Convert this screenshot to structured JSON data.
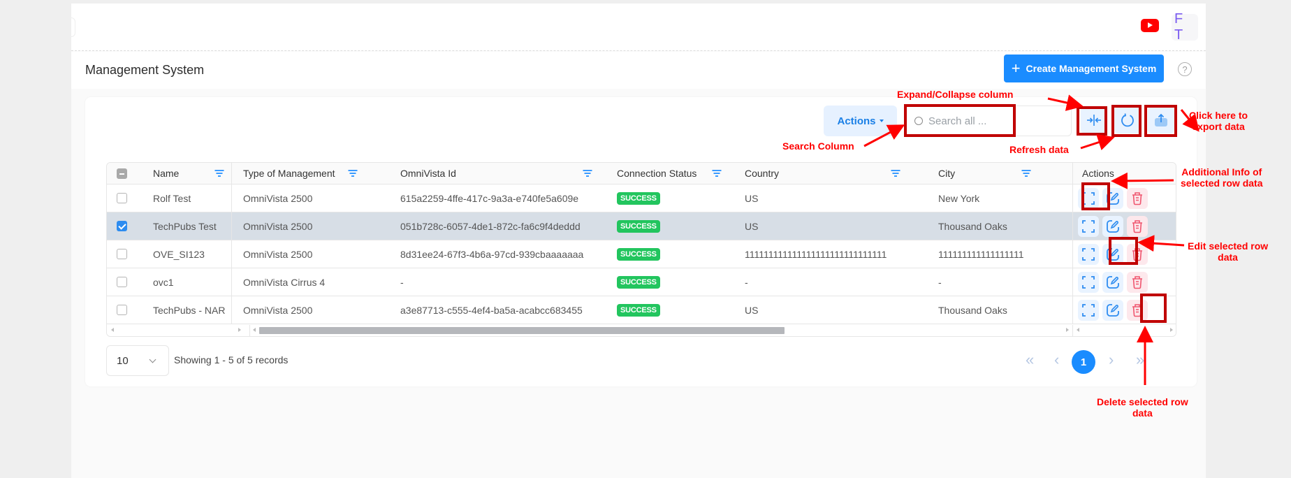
{
  "topbar": {
    "youtube_icon": "youtube-icon",
    "avatar_initials": "F T"
  },
  "page": {
    "title": "Management System",
    "create_button_label": "Create Management System",
    "create_button_icon": "plus-icon",
    "help_icon_glyph": "?"
  },
  "toolbar": {
    "actions_label": "Actions",
    "search_placeholder": "Search all ...",
    "search_value": "",
    "expand_collapse_icon": "expand-collapse-icon",
    "refresh_icon": "refresh-icon",
    "export_icon": "export-icon"
  },
  "table": {
    "columns": [
      {
        "key": "name",
        "label": "Name"
      },
      {
        "key": "type",
        "label": "Type of Management"
      },
      {
        "key": "omnivista_id",
        "label": "OmniVista Id"
      },
      {
        "key": "status",
        "label": "Connection Status"
      },
      {
        "key": "country",
        "label": "Country"
      },
      {
        "key": "city",
        "label": "City"
      },
      {
        "key": "actions",
        "label": "Actions"
      }
    ],
    "rows": [
      {
        "name": "Rolf Test",
        "type": "OmniVista 2500",
        "omnivista_id": "615a2259-4ffe-417c-9a3a-e740fe5a609e",
        "status": "SUCCESS",
        "country": "US",
        "city": "New York",
        "selected": false
      },
      {
        "name": "TechPubs Test",
        "type": "OmniVista 2500",
        "omnivista_id": "051b728c-6057-4de1-872c-fa6c9f4deddd",
        "status": "SUCCESS",
        "country": "US",
        "city": "Thousand Oaks",
        "selected": true
      },
      {
        "name": "OVE_SI123",
        "type": "OmniVista 2500",
        "omnivista_id": "8d31ee24-67f3-4b6a-97cd-939cbaaaaaaa",
        "status": "SUCCESS",
        "country": "111111111111111111111111111111",
        "city": "111111111111111111",
        "selected": false
      },
      {
        "name": "ovc1",
        "type": "OmniVista Cirrus 4",
        "omnivista_id": "-",
        "status": "SUCCESS",
        "country": "-",
        "city": "-",
        "selected": false
      },
      {
        "name": "TechPubs - NAR",
        "type": "OmniVista 2500",
        "omnivista_id": "a3e87713-c555-4ef4-ba5a-acabcc683455",
        "status": "SUCCESS",
        "country": "US",
        "city": "Thousand Oaks",
        "selected": false
      }
    ],
    "row_action_icons": [
      "info-expand-icon",
      "edit-icon",
      "delete-icon"
    ]
  },
  "footer": {
    "page_size": "10",
    "records_text": "Showing 1 - 5 of 5 records",
    "current_page": "1",
    "first_glyph": "«",
    "prev_glyph": "‹",
    "next_glyph": "›",
    "last_glyph": "»"
  },
  "annotations": {
    "expand_collapse": "Expand/Collapse column",
    "search_column": "Search Column",
    "refresh_data": "Refresh data",
    "export_data": "Click here to\nexport data",
    "additional_info": "Additional Info of\nselected row data",
    "edit_row": "Edit selected row\ndata",
    "delete_row": "Delete selected row\ndata"
  },
  "colors": {
    "primary": "#1a8cff",
    "success": "#22c55e",
    "danger": "#f0566f",
    "annotation": "#ff0000",
    "selected_row": "#d7dee6"
  }
}
